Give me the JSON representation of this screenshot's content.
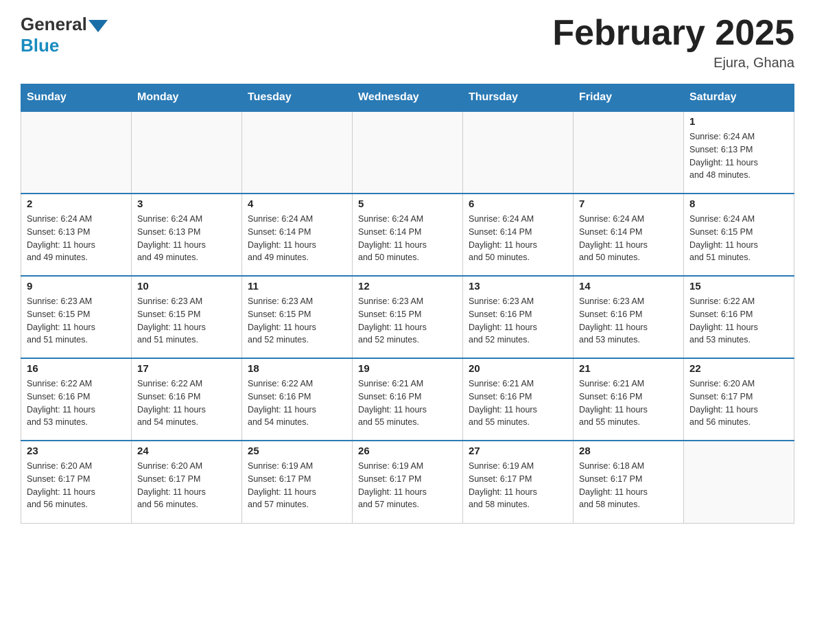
{
  "header": {
    "logo_general": "General",
    "logo_blue": "Blue",
    "title": "February 2025",
    "subtitle": "Ejura, Ghana"
  },
  "days_of_week": [
    "Sunday",
    "Monday",
    "Tuesday",
    "Wednesday",
    "Thursday",
    "Friday",
    "Saturday"
  ],
  "weeks": [
    [
      {
        "day": "",
        "info": ""
      },
      {
        "day": "",
        "info": ""
      },
      {
        "day": "",
        "info": ""
      },
      {
        "day": "",
        "info": ""
      },
      {
        "day": "",
        "info": ""
      },
      {
        "day": "",
        "info": ""
      },
      {
        "day": "1",
        "info": "Sunrise: 6:24 AM\nSunset: 6:13 PM\nDaylight: 11 hours\nand 48 minutes."
      }
    ],
    [
      {
        "day": "2",
        "info": "Sunrise: 6:24 AM\nSunset: 6:13 PM\nDaylight: 11 hours\nand 49 minutes."
      },
      {
        "day": "3",
        "info": "Sunrise: 6:24 AM\nSunset: 6:13 PM\nDaylight: 11 hours\nand 49 minutes."
      },
      {
        "day": "4",
        "info": "Sunrise: 6:24 AM\nSunset: 6:14 PM\nDaylight: 11 hours\nand 49 minutes."
      },
      {
        "day": "5",
        "info": "Sunrise: 6:24 AM\nSunset: 6:14 PM\nDaylight: 11 hours\nand 50 minutes."
      },
      {
        "day": "6",
        "info": "Sunrise: 6:24 AM\nSunset: 6:14 PM\nDaylight: 11 hours\nand 50 minutes."
      },
      {
        "day": "7",
        "info": "Sunrise: 6:24 AM\nSunset: 6:14 PM\nDaylight: 11 hours\nand 50 minutes."
      },
      {
        "day": "8",
        "info": "Sunrise: 6:24 AM\nSunset: 6:15 PM\nDaylight: 11 hours\nand 51 minutes."
      }
    ],
    [
      {
        "day": "9",
        "info": "Sunrise: 6:23 AM\nSunset: 6:15 PM\nDaylight: 11 hours\nand 51 minutes."
      },
      {
        "day": "10",
        "info": "Sunrise: 6:23 AM\nSunset: 6:15 PM\nDaylight: 11 hours\nand 51 minutes."
      },
      {
        "day": "11",
        "info": "Sunrise: 6:23 AM\nSunset: 6:15 PM\nDaylight: 11 hours\nand 52 minutes."
      },
      {
        "day": "12",
        "info": "Sunrise: 6:23 AM\nSunset: 6:15 PM\nDaylight: 11 hours\nand 52 minutes."
      },
      {
        "day": "13",
        "info": "Sunrise: 6:23 AM\nSunset: 6:16 PM\nDaylight: 11 hours\nand 52 minutes."
      },
      {
        "day": "14",
        "info": "Sunrise: 6:23 AM\nSunset: 6:16 PM\nDaylight: 11 hours\nand 53 minutes."
      },
      {
        "day": "15",
        "info": "Sunrise: 6:22 AM\nSunset: 6:16 PM\nDaylight: 11 hours\nand 53 minutes."
      }
    ],
    [
      {
        "day": "16",
        "info": "Sunrise: 6:22 AM\nSunset: 6:16 PM\nDaylight: 11 hours\nand 53 minutes."
      },
      {
        "day": "17",
        "info": "Sunrise: 6:22 AM\nSunset: 6:16 PM\nDaylight: 11 hours\nand 54 minutes."
      },
      {
        "day": "18",
        "info": "Sunrise: 6:22 AM\nSunset: 6:16 PM\nDaylight: 11 hours\nand 54 minutes."
      },
      {
        "day": "19",
        "info": "Sunrise: 6:21 AM\nSunset: 6:16 PM\nDaylight: 11 hours\nand 55 minutes."
      },
      {
        "day": "20",
        "info": "Sunrise: 6:21 AM\nSunset: 6:16 PM\nDaylight: 11 hours\nand 55 minutes."
      },
      {
        "day": "21",
        "info": "Sunrise: 6:21 AM\nSunset: 6:16 PM\nDaylight: 11 hours\nand 55 minutes."
      },
      {
        "day": "22",
        "info": "Sunrise: 6:20 AM\nSunset: 6:17 PM\nDaylight: 11 hours\nand 56 minutes."
      }
    ],
    [
      {
        "day": "23",
        "info": "Sunrise: 6:20 AM\nSunset: 6:17 PM\nDaylight: 11 hours\nand 56 minutes."
      },
      {
        "day": "24",
        "info": "Sunrise: 6:20 AM\nSunset: 6:17 PM\nDaylight: 11 hours\nand 56 minutes."
      },
      {
        "day": "25",
        "info": "Sunrise: 6:19 AM\nSunset: 6:17 PM\nDaylight: 11 hours\nand 57 minutes."
      },
      {
        "day": "26",
        "info": "Sunrise: 6:19 AM\nSunset: 6:17 PM\nDaylight: 11 hours\nand 57 minutes."
      },
      {
        "day": "27",
        "info": "Sunrise: 6:19 AM\nSunset: 6:17 PM\nDaylight: 11 hours\nand 58 minutes."
      },
      {
        "day": "28",
        "info": "Sunrise: 6:18 AM\nSunset: 6:17 PM\nDaylight: 11 hours\nand 58 minutes."
      },
      {
        "day": "",
        "info": ""
      }
    ]
  ]
}
